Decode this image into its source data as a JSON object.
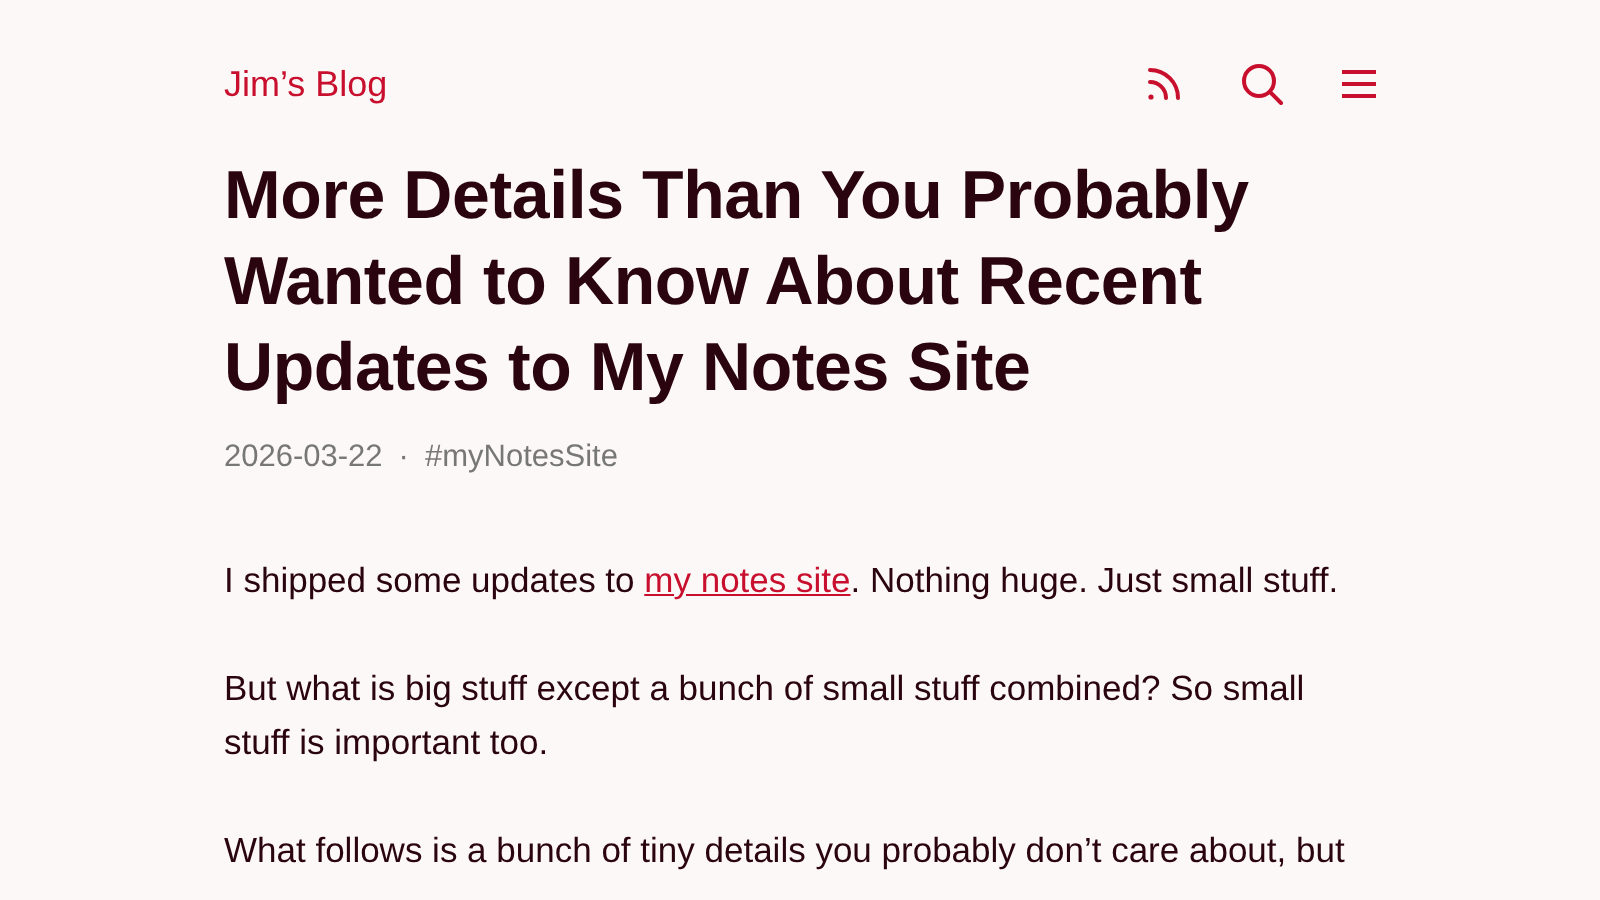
{
  "header": {
    "site_title": "Jim’s Blog"
  },
  "post": {
    "title": "More Details Than You Probably Wanted to Know About Recent Updates to My Notes Site",
    "meta": {
      "date": "2026-03-22",
      "separator": "·",
      "tag": "#myNotesSite"
    },
    "paragraphs": [
      {
        "before": "I shipped some updates to ",
        "link": "my notes site",
        "after": ". Nothing huge. Just small stuff."
      },
      {
        "before": "But what is big stuff except a bunch of small stuff combined? So small stuff is important too."
      },
      {
        "before": "What follows is a bunch of tiny details you probably don’t care about, but"
      }
    ]
  }
}
